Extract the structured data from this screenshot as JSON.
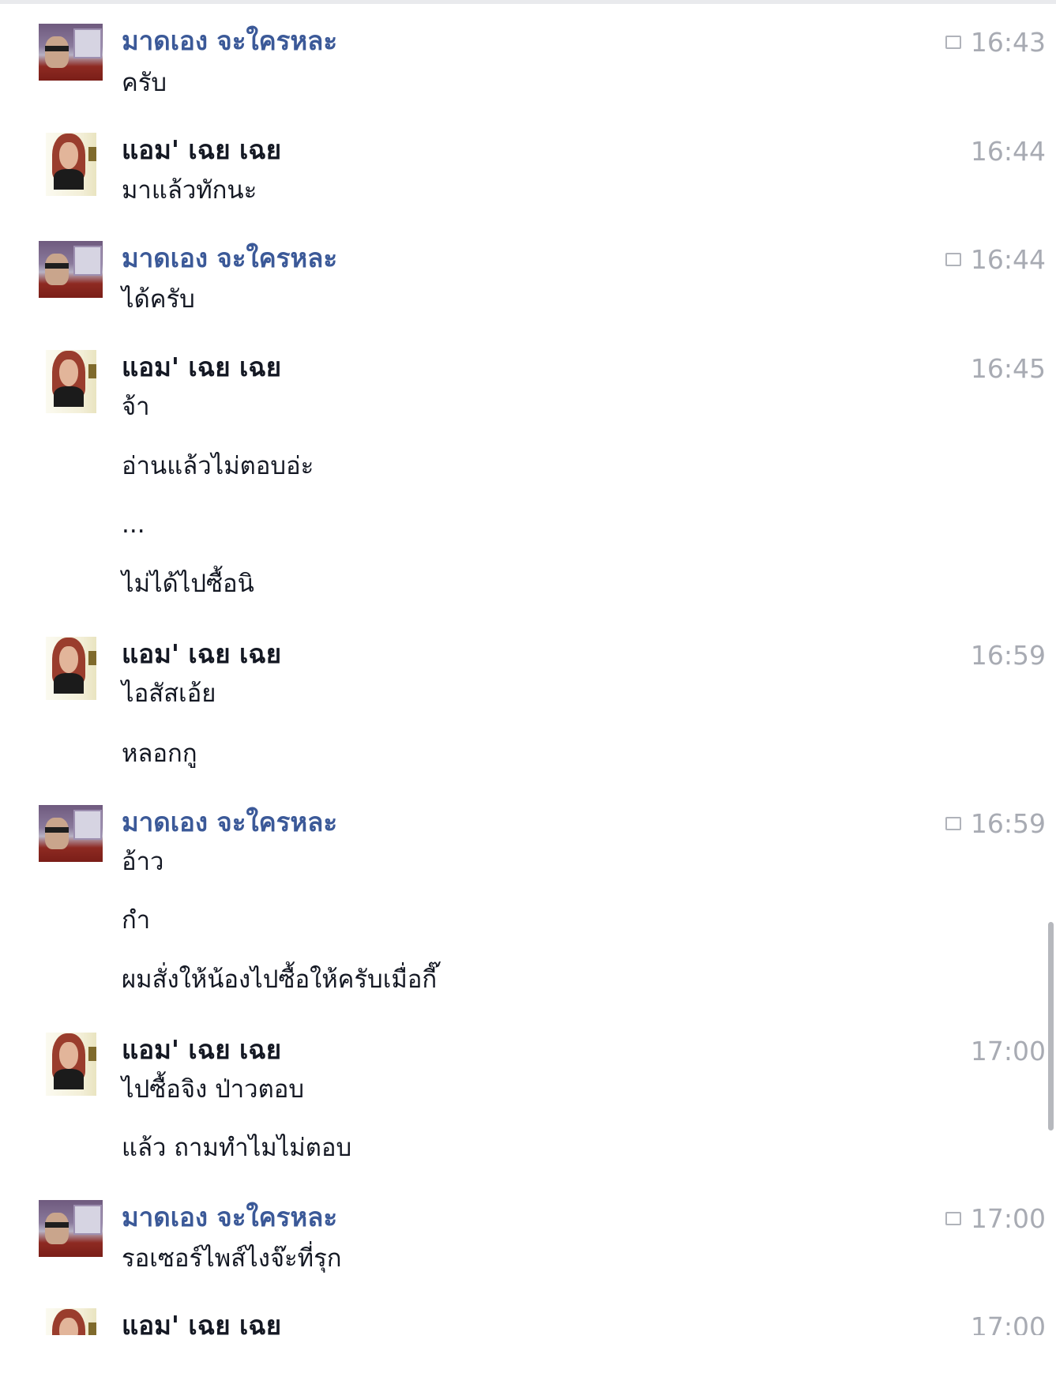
{
  "conversation": {
    "messages": [
      {
        "sender": "มาดเอง จะใครหละ",
        "time": "16:43",
        "seen": true,
        "texts": [
          "ครับ"
        ]
      },
      {
        "sender": "แอม' เฉย เฉย",
        "time": "16:44",
        "seen": false,
        "texts": [
          "มาแล้วทักนะ"
        ]
      },
      {
        "sender": "มาดเอง จะใครหละ",
        "time": "16:44",
        "seen": true,
        "texts": [
          "ได้ครับ"
        ]
      },
      {
        "sender": "แอม' เฉย เฉย",
        "time": "16:45",
        "seen": false,
        "texts": [
          "จ้า",
          "อ่านแล้วไม่ตอบอ่ะ",
          "...",
          "ไม่ได้ไปซื้อนิ"
        ]
      },
      {
        "sender": "แอม' เฉย เฉย",
        "time": "16:59",
        "seen": false,
        "texts": [
          "ไอสัสเอ้ย",
          "หลอกกู"
        ]
      },
      {
        "sender": "มาดเอง จะใครหละ",
        "time": "16:59",
        "seen": true,
        "texts": [
          "อ้าว",
          "กำ",
          "ผมสั่งให้น้องไปซื้อให้ครับเมื่อกี๊"
        ]
      },
      {
        "sender": "แอม' เฉย เฉย",
        "time": "17:00",
        "seen": false,
        "texts": [
          "ไปซื้อจิง ป่าวตอบ",
          "แล้ว ถามทำไมไม่ตอบ"
        ]
      },
      {
        "sender": "มาดเอง จะใครหละ",
        "time": "17:00",
        "seen": true,
        "texts": [
          "รอเซอร์ไพส์ไงจ๊ะที่รุก"
        ]
      },
      {
        "sender": "แอม' เฉย เฉย",
        "time": "17:00",
        "seen": false,
        "texts": []
      }
    ]
  },
  "colors": {
    "sender_me": "#3b5998",
    "sender_other": "#141823",
    "timestamp": "#a8abb3",
    "seen_icon": "#b0b3ba"
  },
  "icons": {
    "seen": "seen-chat-bubble-icon"
  }
}
